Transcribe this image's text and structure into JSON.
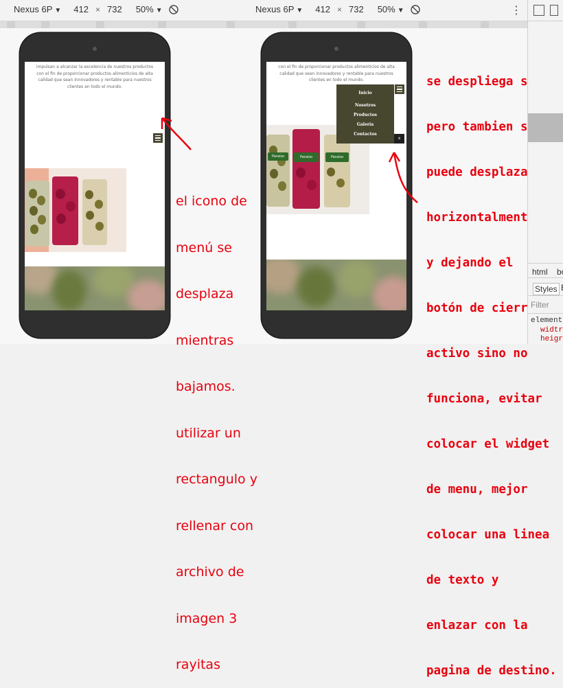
{
  "toolbar": {
    "left": {
      "device": "Nexus 6P",
      "width": "412",
      "sep": "×",
      "height": "732",
      "zoom": "50%"
    },
    "right": {
      "device": "Nexus 6P",
      "width": "412",
      "sep": "×",
      "height": "732",
      "zoom": "50%"
    },
    "more_icon": "⋮"
  },
  "devtools": {
    "tabs": [
      "html",
      "bo"
    ],
    "styles_label": "Styles",
    "styles_extra": "E",
    "filter_placeholder": "Filter",
    "element_label": "element",
    "props": [
      "widtr",
      "heigr"
    ]
  },
  "page": {
    "intro_lines": [
      "impulsan a alcanzar la excelencia de nuestros productos",
      "con el fin de proporcionar productos alimenticios de alta",
      "calidad que sean innovadores y rentable para nuestros",
      "clientes en todo el mundo."
    ],
    "menu_items": [
      "Inicio",
      "Nosotros",
      "Productos",
      "Galeria",
      "Contactos"
    ],
    "close_label": "x",
    "product_labels": [
      "Paraíso",
      "Paraíso",
      "Paraíso"
    ]
  },
  "annotations": {
    "left": [
      "el icono de",
      "menú se",
      "desplaza",
      "mientras",
      "bajamos.",
      "utilizar un",
      "rectangulo y",
      "rellenar con",
      "archivo de",
      "imagen 3",
      "rayitas"
    ],
    "right": [
      "se despliega suave",
      "pero tambien se",
      "puede desplazar",
      "horizontalmente",
      "y dejando el",
      "botón de cierre",
      "activo sino no",
      "funciona, evitar",
      "colocar el widget",
      "de menu, mejor",
      "colocar una linea",
      "de texto y",
      "enlazar con la",
      "pagina de destino."
    ]
  },
  "colors": {
    "annotation": "#e8000e",
    "menu_bg": "#47462f",
    "phone": "#2f2f2f"
  }
}
